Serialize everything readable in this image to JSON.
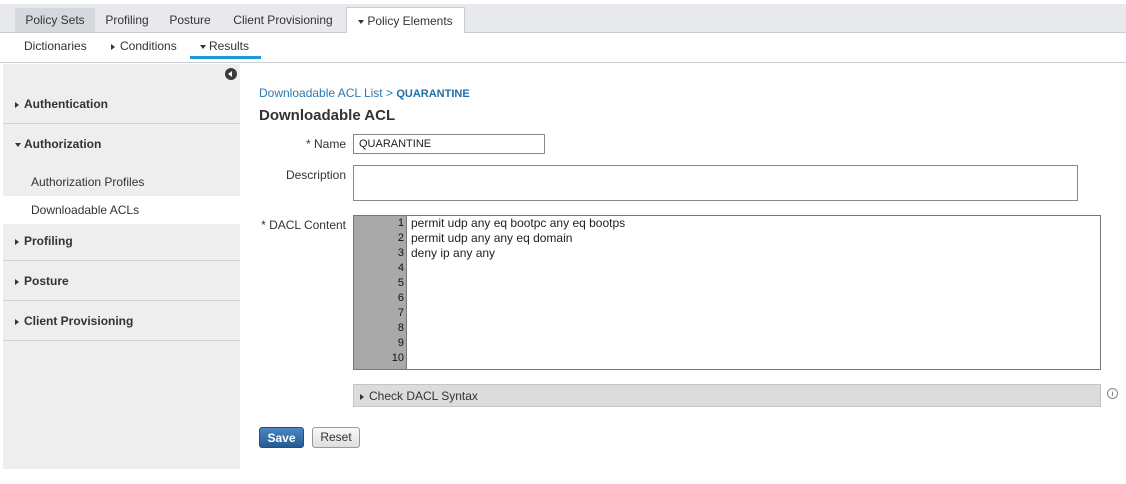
{
  "top_tabs": [
    {
      "label": "Policy Sets"
    },
    {
      "label": "Profiling"
    },
    {
      "label": "Posture"
    },
    {
      "label": "Client Provisioning"
    },
    {
      "label": "Policy Elements"
    }
  ],
  "sub_nav": {
    "dictionaries": "Dictionaries",
    "conditions": "Conditions",
    "results": "Results"
  },
  "sidebar": {
    "authentication": "Authentication",
    "authorization": "Authorization",
    "authorization_profiles": "Authorization Profiles",
    "downloadable_acls": "Downloadable ACLs",
    "profiling": "Profiling",
    "posture": "Posture",
    "client_provisioning": "Client Provisioning"
  },
  "breadcrumb": {
    "parent": "Downloadable ACL List",
    "separator": ">",
    "current": "QUARANTINE"
  },
  "page_title": "Downloadable ACL",
  "form": {
    "name_label": "* Name",
    "name_value": "QUARANTINE",
    "description_label": "Description",
    "description_value": "",
    "dacl_label": "* DACL Content",
    "line_numbers": [
      "1",
      "2",
      "3",
      "4",
      "5",
      "6",
      "7",
      "8",
      "9",
      "10"
    ],
    "dacl_lines": [
      "permit udp any eq bootpc any eq bootps",
      "permit udp any any eq domain",
      "deny ip any any"
    ],
    "check_syntax_label": "Check DACL Syntax"
  },
  "buttons": {
    "save": "Save",
    "reset": "Reset"
  },
  "icons": {
    "collapse": "collapse-left-icon",
    "info": "info-icon"
  },
  "colors": {
    "accent": "#1a9bd7",
    "save_button": "#2f6aa8",
    "link": "#2a7ab0"
  }
}
